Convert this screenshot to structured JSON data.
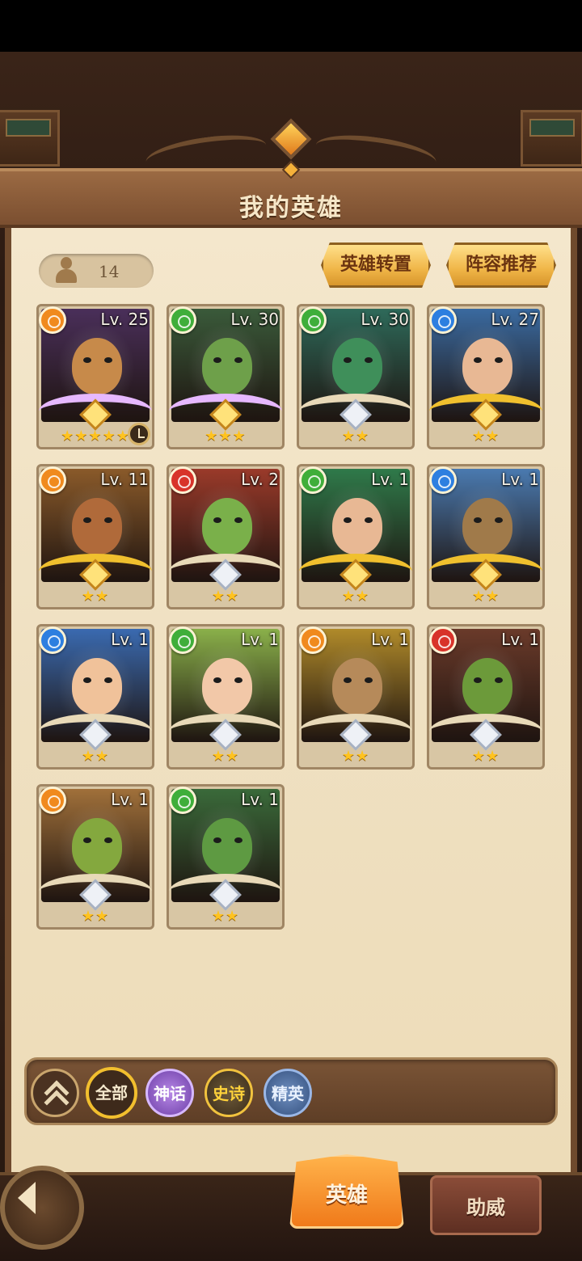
{
  "title": "我的英雄",
  "hero_count": "14",
  "buttons": {
    "transfer": "英雄转置",
    "recommend": "阵容推荐"
  },
  "heroes": [
    {
      "level": "Lv. 25",
      "stars": "★★★★★",
      "element": "orange",
      "frame": "myth"
    },
    {
      "level": "Lv. 30",
      "stars": "★★★",
      "element": "green",
      "frame": "myth"
    },
    {
      "level": "Lv. 30",
      "stars": "★★",
      "element": "green",
      "frame": "silver"
    },
    {
      "level": "Lv. 27",
      "stars": "★★",
      "element": "blue",
      "frame": "gold"
    },
    {
      "level": "Lv. 11",
      "stars": "★★",
      "element": "orange",
      "frame": "gold"
    },
    {
      "level": "Lv. 2",
      "stars": "★★",
      "element": "red",
      "frame": "silver"
    },
    {
      "level": "Lv. 1",
      "stars": "★★",
      "element": "green",
      "frame": "gold"
    },
    {
      "level": "Lv. 1",
      "stars": "★★",
      "element": "blue",
      "frame": "gold"
    },
    {
      "level": "Lv. 1",
      "stars": "★★",
      "element": "blue",
      "frame": "silver"
    },
    {
      "level": "Lv. 1",
      "stars": "★★",
      "element": "green",
      "frame": "silver"
    },
    {
      "level": "Lv. 1",
      "stars": "★★",
      "element": "orange",
      "frame": "silver"
    },
    {
      "level": "Lv. 1",
      "stars": "★★",
      "element": "red",
      "frame": "silver"
    },
    {
      "level": "Lv. 1",
      "stars": "★★",
      "element": "orange",
      "frame": "silver"
    },
    {
      "level": "Lv. 1",
      "stars": "★★",
      "element": "green",
      "frame": "silver"
    }
  ],
  "filters": {
    "all": "全部",
    "myth": "神话",
    "epic": "史诗",
    "elite": "精英"
  },
  "tabs": {
    "heroes": "英雄",
    "support": "助威"
  },
  "colors": {
    "orange": "#f08a1e",
    "green": "#3fae3a",
    "blue": "#2d7fe0",
    "red": "#d8332a"
  }
}
